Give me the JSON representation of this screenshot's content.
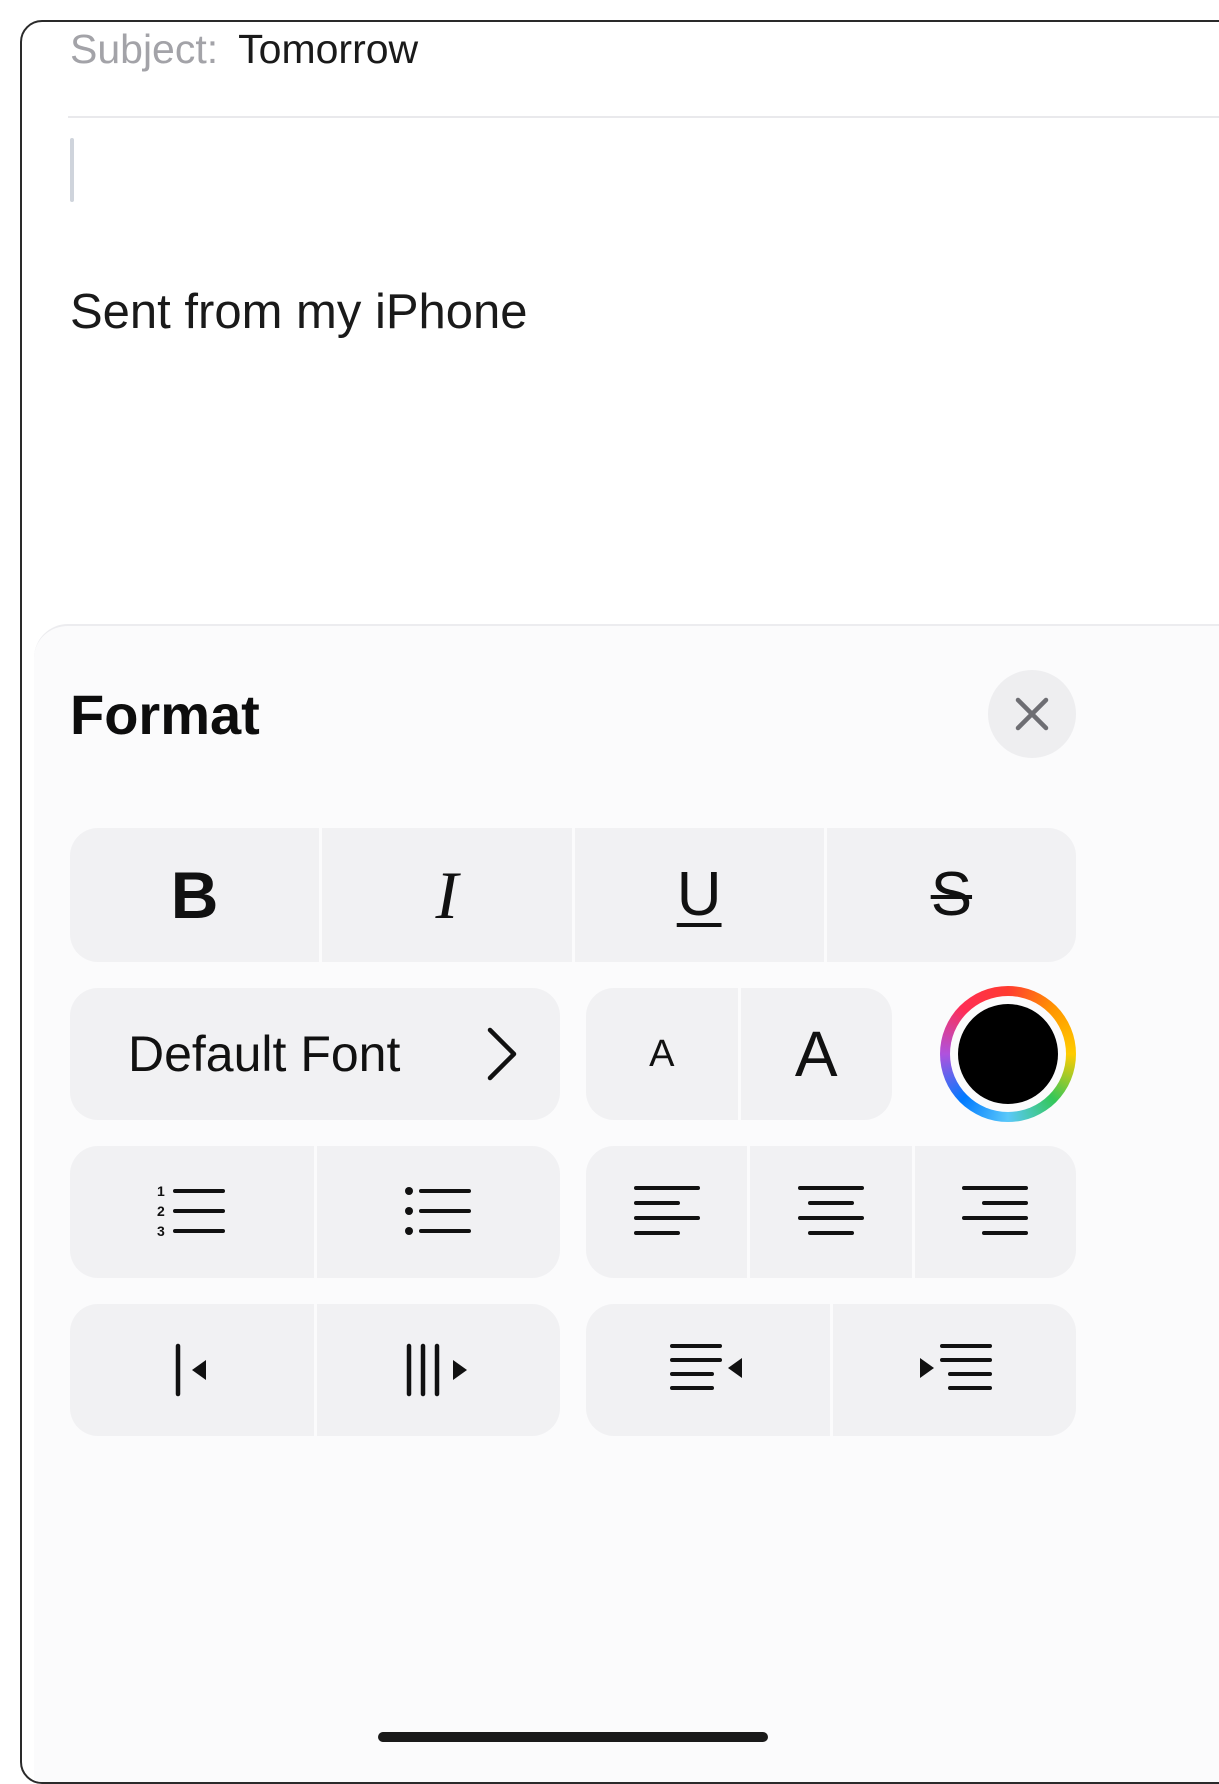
{
  "compose": {
    "subject_label": "Subject:",
    "subject_value": "Tomorrow",
    "signature": "Sent from my iPhone"
  },
  "format_panel": {
    "title": "Format",
    "close_icon": "xmark-icon",
    "style_buttons": [
      {
        "label": "B",
        "name": "bold"
      },
      {
        "label": "I",
        "name": "italic"
      },
      {
        "label": "U",
        "name": "underline"
      },
      {
        "label": "S",
        "name": "strikethrough"
      }
    ],
    "font_button": {
      "label": "Default Font",
      "icon": "chevron-right-icon"
    },
    "size_buttons": [
      {
        "label": "A",
        "name": "decrease-font-size"
      },
      {
        "label": "A",
        "name": "increase-font-size"
      }
    ],
    "text_color": "#000000",
    "list_buttons": [
      "numbered-list-icon",
      "bulleted-list-icon"
    ],
    "align_buttons": [
      "align-left-icon",
      "align-center-icon",
      "align-right-icon"
    ],
    "indent_buttons": [
      "decrease-list-indent-icon",
      "increase-list-indent-icon"
    ],
    "quote_buttons": [
      "decrease-indent-icon",
      "increase-indent-icon"
    ]
  }
}
